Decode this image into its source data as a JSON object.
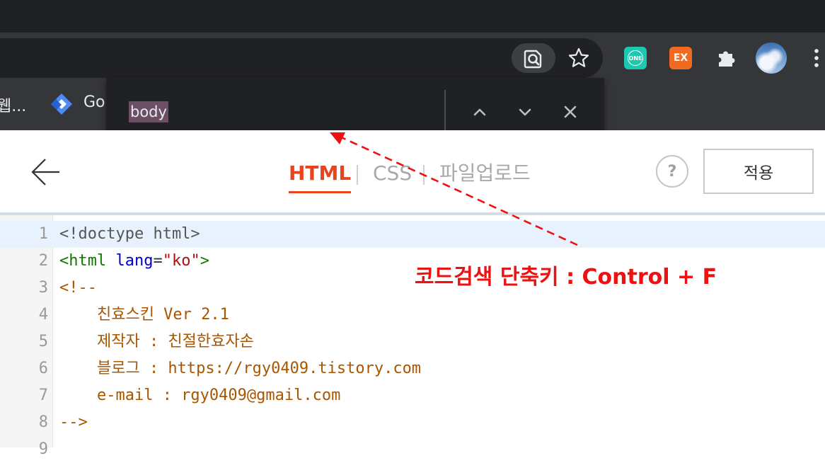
{
  "browser": {
    "ext_one_label": "ONE",
    "ext_ex_label": "EX",
    "bookmarks": [
      "웹...",
      "Go"
    ],
    "colors": {
      "frame": "#202124",
      "toolbar": "#35363a",
      "ext_one": "#1ec8b0",
      "ext_ex": "#f26a22"
    }
  },
  "find_bar": {
    "query": "body",
    "prev_icon": "chevron-up-icon",
    "next_icon": "chevron-down-icon",
    "close_icon": "close-icon"
  },
  "editor": {
    "back_icon": "arrow-left-icon",
    "tabs": [
      {
        "label": "HTML",
        "active": true
      },
      {
        "label": "CSS",
        "active": false
      },
      {
        "label": "파일업로드",
        "active": false
      }
    ],
    "help_label": "?",
    "apply_label": "적용",
    "accent": "#e8431c"
  },
  "code": {
    "line_numbers": [
      "1",
      "2",
      "3",
      "4",
      "5",
      "6",
      "7",
      "8",
      "9"
    ],
    "l1": "<!doctype html>",
    "l2_open": "<html",
    "l2_attr": "lang",
    "l2_eq": "=",
    "l2_val": "\"ko\"",
    "l2_close": ">",
    "l3": "<!--",
    "l4": "    친효스킨 Ver 2.1",
    "l5": "    제작자 : 친절한효자손",
    "l6": "    블로그 : https://rgy0409.tistory.com",
    "l7": "    e-mail : rgy0409@gmail.com",
    "l8": "-->",
    "l9": ""
  },
  "annotation": {
    "text": "코드검색 단축키 : Control + F",
    "color": "#ee1111"
  }
}
